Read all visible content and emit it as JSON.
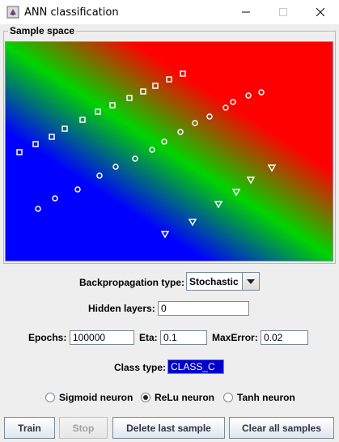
{
  "window": {
    "title": "ANN classification"
  },
  "sample_space": {
    "label": "Sample space"
  },
  "samples": {
    "class_a": [
      [
        17,
        136
      ],
      [
        37,
        126
      ],
      [
        57,
        117
      ],
      [
        73,
        107
      ],
      [
        95,
        96
      ],
      [
        114,
        86
      ],
      [
        132,
        78
      ],
      [
        153,
        69
      ],
      [
        170,
        61
      ],
      [
        185,
        54
      ],
      [
        202,
        46
      ],
      [
        219,
        39
      ]
    ],
    "class_b": [
      [
        40,
        206
      ],
      [
        61,
        193
      ],
      [
        89,
        182
      ],
      [
        116,
        165
      ],
      [
        136,
        154
      ],
      [
        160,
        144
      ],
      [
        181,
        133
      ],
      [
        196,
        123
      ],
      [
        216,
        111
      ],
      [
        234,
        100
      ],
      [
        252,
        92
      ],
      [
        272,
        81
      ],
      [
        281,
        74
      ],
      [
        300,
        66
      ],
      [
        316,
        62
      ]
    ],
    "class_c": [
      [
        197,
        237
      ],
      [
        231,
        222
      ],
      [
        263,
        200
      ],
      [
        285,
        185
      ],
      [
        303,
        170
      ],
      [
        329,
        155
      ]
    ]
  },
  "backprop": {
    "label": "Backpropagation type:",
    "value": "Stochastic"
  },
  "hidden_layers": {
    "label": "Hidden layers:",
    "value": "0"
  },
  "epochs": {
    "label": "Epochs:",
    "value": "100000"
  },
  "eta": {
    "label": "Eta:",
    "value": "0.1"
  },
  "max_error": {
    "label": "MaxError:",
    "value": "0.02"
  },
  "class_type": {
    "label": "Class type:",
    "value": "CLASS_C"
  },
  "neurons": [
    {
      "label": "Sigmoid neuron",
      "selected": false
    },
    {
      "label": "ReLu neuron",
      "selected": true
    },
    {
      "label": "Tanh neuron",
      "selected": false
    }
  ],
  "buttons": {
    "train": "Train",
    "stop": "Stop",
    "delete_last": "Delete last sample",
    "clear_all": "Clear all samples"
  }
}
